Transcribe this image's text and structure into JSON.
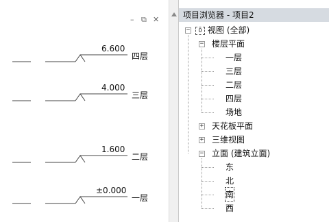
{
  "view": {
    "window_controls": {
      "minimize": "–",
      "restore": "⧉",
      "close": "✕"
    },
    "levels": [
      {
        "elevation": "6.600",
        "name": "四层"
      },
      {
        "elevation": "4.000",
        "name": "三层"
      },
      {
        "elevation": "1.600",
        "name": "二层"
      },
      {
        "elevation": "±0.000",
        "name": "一层"
      }
    ]
  },
  "browser": {
    "title": "项目浏览器 - 项目2",
    "tree": {
      "root": "视图 (全部)",
      "floor_plans": {
        "label": "楼层平面",
        "items": [
          "一层",
          "三层",
          "二层",
          "四层",
          "场地"
        ]
      },
      "ceiling_plans": "天花板平面",
      "views_3d": "三维视图",
      "elevations": {
        "label": "立面 (建筑立面)",
        "items": [
          "东",
          "北",
          "南",
          "西"
        ]
      }
    }
  }
}
